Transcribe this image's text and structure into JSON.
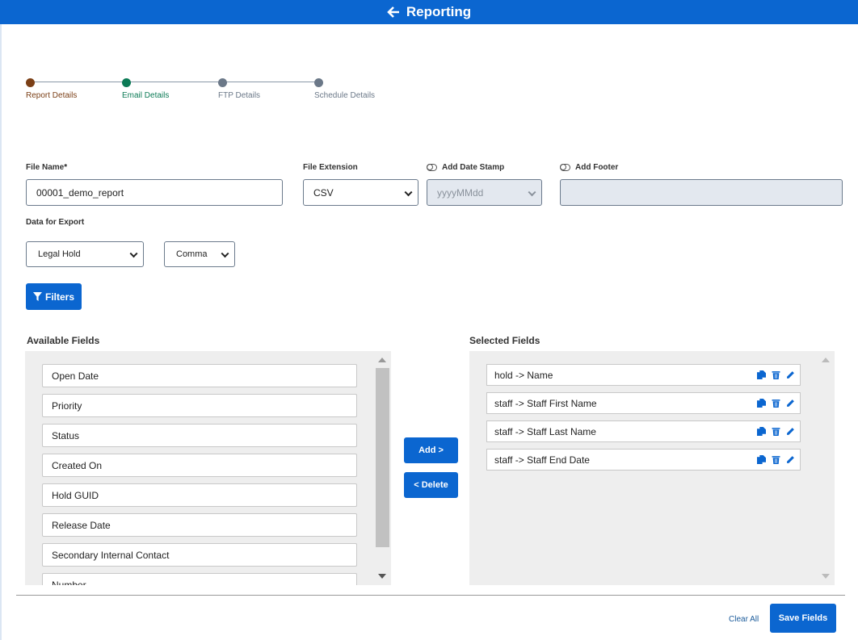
{
  "header": {
    "title": "Reporting",
    "back_icon": "arrow-left-icon",
    "color": "#0b66d0"
  },
  "steps": [
    {
      "label": "Report Details",
      "color": "#7b3f16"
    },
    {
      "label": "Email Details",
      "color": "#0b7a55"
    },
    {
      "label": "FTP Details",
      "color": "#6b7888"
    },
    {
      "label": "Schedule Details",
      "color": "#6b7888"
    }
  ],
  "form": {
    "file_name_label": "File Name",
    "required_mark": "*",
    "file_name_value": "00001_demo_report",
    "file_extension_label": "File Extension",
    "file_extension_value": "CSV",
    "date_stamp_label": "Add Date Stamp",
    "date_stamp_placeholder": "yyyyMMdd",
    "footer_label": "Add Footer",
    "footer_value": "",
    "data_export_label": "Data for Export",
    "data_export_value": "Legal Hold",
    "delimiter_value": "Comma",
    "filters_label": "Filters"
  },
  "available": {
    "title": "Available Fields",
    "items": [
      "Open Date",
      "Priority",
      "Status",
      "Created On",
      "Hold GUID",
      "Release Date",
      "Secondary Internal Contact",
      "Number"
    ]
  },
  "selected": {
    "title": "Selected Fields",
    "items": [
      "hold -> Name",
      "staff -> Staff First Name",
      "staff -> Staff Last Name",
      "staff -> Staff End Date"
    ]
  },
  "actions": {
    "add": "Add >",
    "delete": "< Delete",
    "clear_all": "Clear All",
    "save": "Save Fields"
  }
}
